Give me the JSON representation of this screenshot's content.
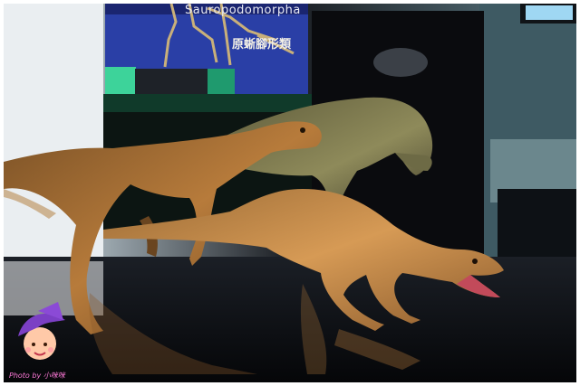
{
  "photo": {
    "sign_text_latin": "Sauropodomorpha",
    "sign_text_cjk": "原蜥腳形類",
    "watermark_text": "Photo by 小咪咪"
  },
  "colors": {
    "sign_blue": "#2a3fa6",
    "floor_black": "#07080b",
    "dino_skin": "#b0753a",
    "pedestal_green": "#1f9a6e"
  }
}
